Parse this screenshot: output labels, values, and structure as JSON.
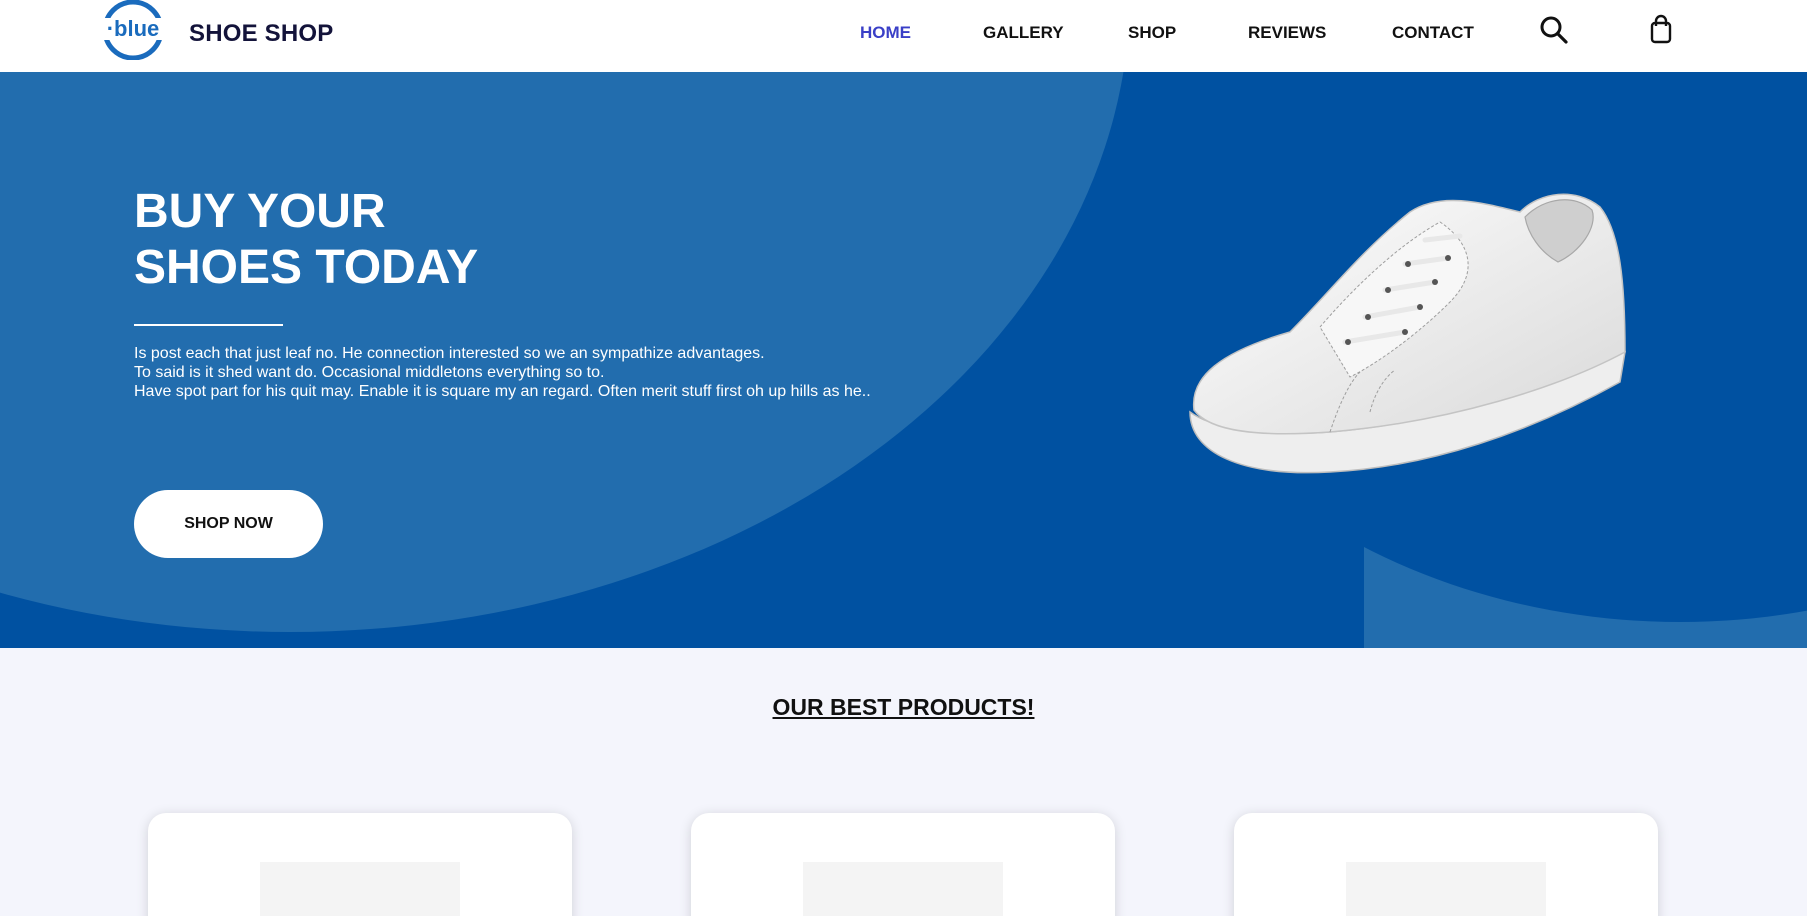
{
  "header": {
    "logo_text": "·blue",
    "brand": "SHOE SHOP",
    "nav": [
      {
        "label": "HOME",
        "active": true
      },
      {
        "label": "GALLERY",
        "active": false
      },
      {
        "label": "SHOP",
        "active": false
      },
      {
        "label": "REVIEWS",
        "active": false
      },
      {
        "label": "CONTACT",
        "active": false
      }
    ],
    "icons": [
      "search-icon",
      "shopping-bag-icon"
    ]
  },
  "hero": {
    "title_line1": "BUY YOUR",
    "title_line2": "SHOES TODAY",
    "text_lines": [
      "Is post each that just leaf no. He connection interested so we an sympathize advantages.",
      "To said is it shed want do. Occasional middletons everything so to.",
      "Have spot part for his quit may. Enable it is square my an regard. Often merit stuff first oh up hills as he.."
    ],
    "cta": "SHOP NOW"
  },
  "products": {
    "title": "OUR BEST PRODUCTS!"
  },
  "colors": {
    "hero_dark": "#0051a1",
    "hero_light": "#226dae",
    "nav_active": "#3a3fc7",
    "page_bg": "#f4f5fc"
  }
}
